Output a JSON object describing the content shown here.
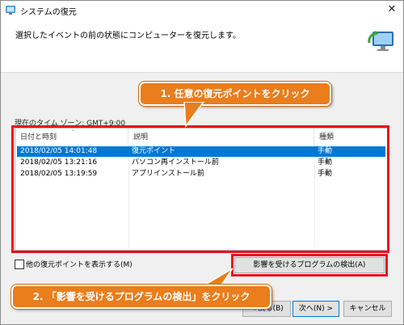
{
  "window": {
    "title": "システムの復元"
  },
  "header": {
    "instruction": "選択したイベントの前の状態にコンピューターを復元します。"
  },
  "timezone_label": "現在のタイム ゾーン: GMT+9:00",
  "table": {
    "columns": [
      "日付と時刻",
      "説明",
      "種類"
    ],
    "rows": [
      [
        "2018/02/05 14:01:48",
        "復元ポイント",
        "手動"
      ],
      [
        "2018/02/05 13:21:16",
        "パソコン再インストール前",
        "手動"
      ],
      [
        "2018/02/05 13:19:59",
        "アプリインストール前",
        "手動"
      ]
    ]
  },
  "checkbox": {
    "label": "他の復元ポイントを表示する(M)"
  },
  "buttons": {
    "scan": "影響を受けるプログラムの検出(A)",
    "back": "< 戻る(B)",
    "next": "次へ(N) >",
    "cancel": "キャンセル"
  },
  "callouts": {
    "step1": "1. 任意の復元ポイントをクリック",
    "step2": "2. 「影響を受けるプログラムの検出」をクリック"
  },
  "colors": {
    "highlight": "#e8101c",
    "callout": "#ea7d1c",
    "selection": "#0078d7"
  }
}
